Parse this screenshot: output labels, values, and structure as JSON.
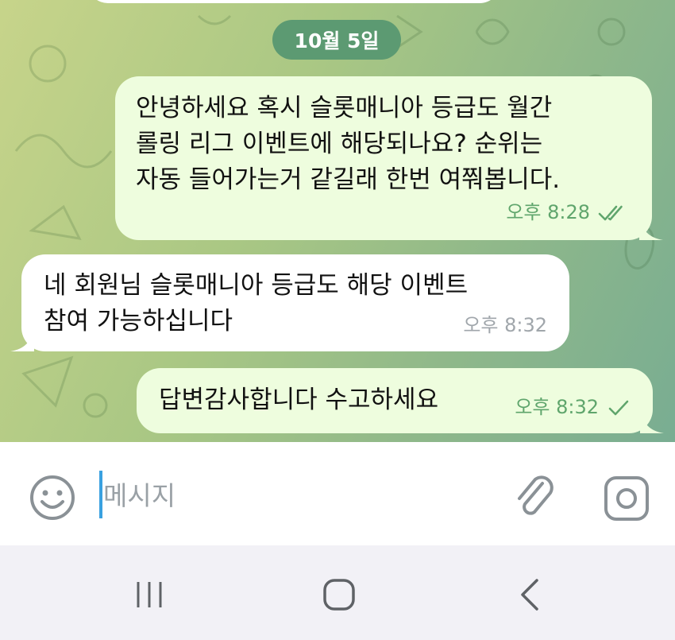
{
  "chat": {
    "date_label": "10월 5일",
    "messages": [
      {
        "direction": "outgoing",
        "text": "안녕하세요 혹시 슬롯매니아 등급도 월간\n롤링 리그 이벤트에 해당되나요? 순위는\n자동 들어가는거 같길래 한번 여쭤봅니다.",
        "time": "오후 8:28",
        "status": "read"
      },
      {
        "direction": "incoming",
        "text": "네 회원님 슬롯매니아 등급도 해당 이벤트\n참여 가능하십니다",
        "time": "오후 8:32"
      },
      {
        "direction": "outgoing",
        "text": "답변감사합니다 수고하세요",
        "time": "오후 8:32",
        "status": "sent"
      }
    ]
  },
  "composer": {
    "placeholder": "메시지",
    "icons": [
      "smiley-icon",
      "paperclip-icon",
      "camera-icon"
    ]
  },
  "navigation": {
    "icons": [
      "recents-icon",
      "home-icon",
      "back-icon"
    ]
  },
  "colors": {
    "outgoing_bubble": "#eefdde",
    "incoming_bubble": "#ffffff",
    "date_pill": "#5c9a72",
    "read_check": "#5fa56c",
    "cursor": "#3aa1e0"
  }
}
